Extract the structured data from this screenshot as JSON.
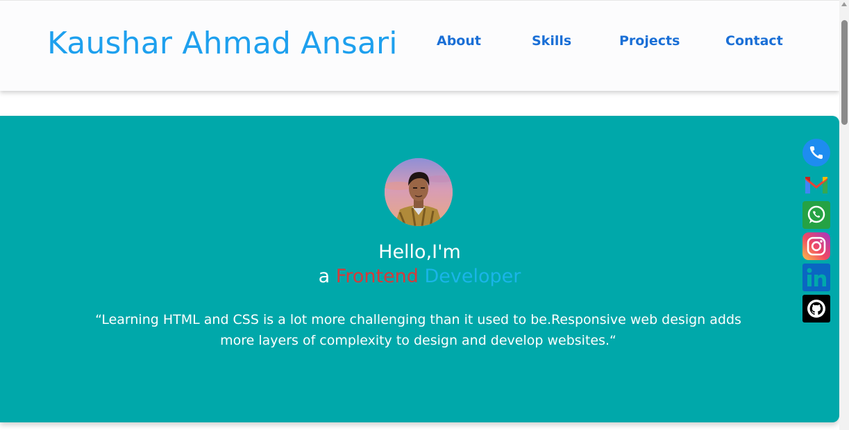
{
  "header": {
    "brand": "Kaushar Ahmad Ansari",
    "nav": {
      "about": "About",
      "skills": "Skills",
      "projects": "Projects",
      "contact": "Contact"
    }
  },
  "hero": {
    "avatar_icon": "profile-photo",
    "greeting": "Hello,I'm",
    "role": {
      "prefix": "a",
      "word1": "Frontend",
      "word2": "Developer"
    },
    "quote": "“Learning HTML and CSS is a lot more challenging than it used to be.Responsive web design adds more layers of complexity to design and develop websites.“"
  },
  "social": [
    {
      "icon": "phone-icon",
      "color": "#1e8cf0"
    },
    {
      "icon": "gmail-icon",
      "color": "#ea4335"
    },
    {
      "icon": "whatsapp-icon",
      "color": "#25a244"
    },
    {
      "icon": "instagram-icon",
      "color": "#e1306c"
    },
    {
      "icon": "linkedin-icon",
      "color": "#0a66c2"
    },
    {
      "icon": "github-icon",
      "color": "#000000"
    }
  ],
  "colors": {
    "brand": "#1ea0ee",
    "nav_link": "#1a6fd6",
    "hero_bg": "#00a8aa",
    "frontend": "#d63a3a",
    "developer": "#1ab5e8"
  }
}
